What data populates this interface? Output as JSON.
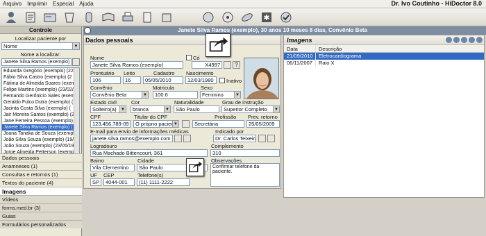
{
  "menu": {
    "items": [
      "Arquivo",
      "Imprimir",
      "Especial",
      "Ajuda"
    ],
    "title": "Dr. Ivo Coutinho - HiDoctor 8.0"
  },
  "toolbar": {
    "icons": [
      "patient-icon",
      "notes-icon",
      "card-icon",
      "recipe-icon",
      "medicine-icon",
      "printer-icon",
      "export-icon",
      "phone-icon",
      "disc-icon",
      "pill-icon",
      "star-icon",
      "check-icon"
    ]
  },
  "banner": {
    "text": "Janete Silva Ramos (exemplo), 30 anos 10 meses 8 dias, Convênio Beta"
  },
  "left": {
    "header": "Controle",
    "locate_label": "Localizar paciente por",
    "locate_value": "Nome",
    "name_label": "Nome a localizar:",
    "name_value": "Janete Silva Ramos (exemplo) (1",
    "patients": [
      "Eduarda Gregório (exemplo) (22/",
      "Fábio Silva Castro (exemplo) (2",
      "Fátima de Almeida Soares (exem",
      "Felipe Martins (exemplo) (23/02/",
      "Fernando Gerônicio Sales (exemp",
      "Geraldo Fulco Dutra (exemplo) (",
      "Jacinta Costa Silva (exemplo) (",
      "Jair Moreira Santos (exemplo) (2",
      "Jane Ferreira Pessoa (exemplo) (",
      "Janete Silva Ramos (exemplo) (1",
      "Joana Tanaka de Souza (exempl",
      "João Silva Souza (exemplo) (19/",
      "João Souza (exemplo) (23/05/19",
      "Jorge Almeida Petterson (exempl",
      "José Fonseca Medeiros (exempl"
    ],
    "selected_index": 9,
    "nav": [
      {
        "label": "Dados pessoais",
        "type": "normal"
      },
      {
        "label": "Anamneses  (1)",
        "type": "normal"
      },
      {
        "label": "Consultas e retornos  (1)",
        "type": "normal"
      },
      {
        "label": "Textos do paciente  (4)",
        "type": "normal"
      },
      {
        "label": "Imagens",
        "type": "active"
      },
      {
        "label": "Vídeos",
        "type": "sub"
      },
      {
        "label": "forms.med.br  (3)",
        "type": "sub"
      },
      {
        "label": "Guias",
        "type": "sub"
      },
      {
        "label": "Formulários personalizados",
        "type": "sub"
      }
    ]
  },
  "dados": {
    "header": "Dados pessoais",
    "nome_label": "Nome",
    "nome": "Janete Silva Ramos (exemplo)",
    "codigo_label": "Có",
    "codigo": "X4997",
    "prontuario_label": "Prontuário",
    "prontuario": "106",
    "leito_label": "Leito",
    "leito": "16",
    "cadastro_label": "Cadastro",
    "cadastro": "05/05/2010",
    "nascimento_label": "Nascimento",
    "nascimento": "12/03/1980",
    "inativo_label": "Inativo",
    "convenio_label": "Convênio",
    "convenio": "Convênio Beta",
    "matricula_label": "Matrícula",
    "matricula": "100.6",
    "sexo_label": "Sexo",
    "sexo": "Feminino",
    "estado_label": "Estado civil",
    "estado": "Solteiro(a)",
    "cor_label": "Cor",
    "cor": "branca",
    "natural_label": "Naturalidade",
    "natural": "São Paulo",
    "grau_label": "Grau de instrução",
    "grau": "Superior Completo",
    "cpf_label": "CPF",
    "cpf": "123.456.789-09",
    "titular_label": "Titular do CPF",
    "titular": "O próprio paciente",
    "profissao_label": "Profissão",
    "profissao": "Secretária",
    "prev_label": "Prev. retorno",
    "prev": "25/05/2009",
    "email_label": "E-mail para envio de informações médicas",
    "email": "janete.silva.ramos@exemplo.com",
    "indicado_label": "Indicado por",
    "indicado": "Dr. Carlos Teixeira",
    "logradouro_label": "Logradouro",
    "logradouro": "Rua Machado Bittencourt, 361",
    "complemento_label": "Complemento",
    "complemento": "310",
    "bairro_label": "Bairro",
    "bairro": "Vila Clementino",
    "cidade_label": "Cidade",
    "cidade": "São Paulo",
    "obs_label": "Observações",
    "obs": "Confirmar telefone da paciente.",
    "uf_label": "UF",
    "uf": "SP",
    "cep_label": "CEP",
    "cep": "4044-001",
    "telefone_label": "Telefone(s)",
    "telefone": "(11) 1111-2222"
  },
  "imagens": {
    "header": "Imagens",
    "columns": [
      "Data",
      "Descrição"
    ],
    "rows": [
      {
        "data": "21/09/2010",
        "desc": "Eletrocardiograma",
        "selected": true
      },
      {
        "data": "06/11/2007",
        "desc": "Raio X",
        "selected": false
      }
    ]
  }
}
